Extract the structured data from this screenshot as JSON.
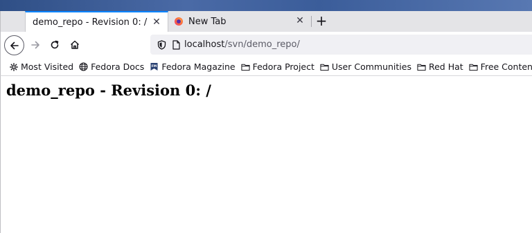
{
  "tabs": [
    {
      "label": "demo_repo - Revision 0: /",
      "active": true,
      "close_glyph": "✕"
    },
    {
      "label": "New Tab",
      "active": false,
      "icon": "firefox-icon",
      "close_glyph": "✕"
    }
  ],
  "new_tab_glyph": "+",
  "navigation": {
    "back_icon": "back-arrow-icon",
    "forward_icon": "forward-arrow-icon",
    "reload_icon": "reload-icon",
    "home_icon": "home-icon"
  },
  "urlbar": {
    "host": "localhost",
    "path": "/svn/demo_repo/",
    "shield_icon": "tracking-protection-shield-icon",
    "page_icon": "page-icon"
  },
  "bookmarks": [
    {
      "label": "Most Visited",
      "icon": "gear-icon"
    },
    {
      "label": "Fedora Docs",
      "icon": "globe-icon"
    },
    {
      "label": "Fedora Magazine",
      "icon": "fedora-magazine-icon"
    },
    {
      "label": "Fedora Project",
      "icon": "folder-icon"
    },
    {
      "label": "User Communities",
      "icon": "folder-icon"
    },
    {
      "label": "Red Hat",
      "icon": "folder-icon"
    },
    {
      "label": "Free Content",
      "icon": "folder-icon"
    }
  ],
  "page": {
    "heading": "demo_repo - Revision 0: /"
  },
  "colors": {
    "active_tab_accent": "#0a84ff",
    "tabstrip_bg": "#e4e4e7",
    "urlbar_bg": "#f0f0f4"
  }
}
